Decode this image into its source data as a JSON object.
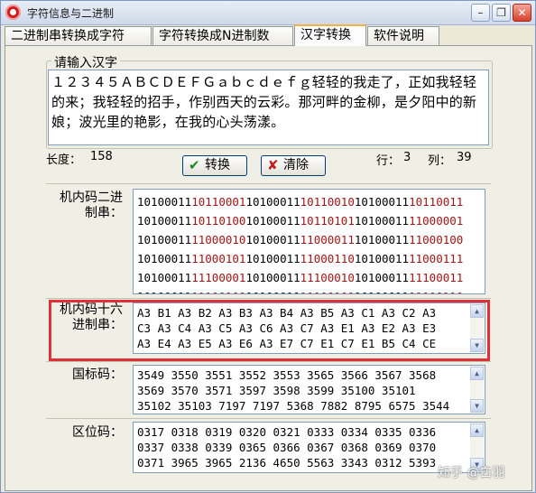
{
  "window": {
    "title": "字符信息与二进制",
    "controls": {
      "minimize": "–",
      "restore": "❐",
      "close": "✕"
    }
  },
  "tabs": [
    {
      "label": "二进制串转换成字符",
      "active": false
    },
    {
      "label": "字符转换成N进制数",
      "active": false
    },
    {
      "label": "汉字转换",
      "active": true
    },
    {
      "label": "软件说明",
      "active": false
    }
  ],
  "input_group": {
    "legend": "请输入汉字",
    "text": "１２３４５ＡＢＣＤＥＦＧａｂｃｄｅｆｇ轻轻的我走了，正如我轻轻的来；我轻轻的招手，作别西天的云彩。那河畔的金柳，是夕阳中的新娘；波光里的艳影，在我的心头荡漾。"
  },
  "stats": {
    "length_label": "长度：",
    "length_value": "158",
    "row_label": "行：",
    "row_value": "3",
    "col_label": "列：",
    "col_value": "39"
  },
  "buttons": {
    "convert": "转换",
    "clear": "清除"
  },
  "binary": {
    "label": "机内码二进制串：",
    "lines": [
      [
        "10100011",
        "10110001",
        "10100011",
        "10110010",
        "10100011",
        "10110011"
      ],
      [
        "10100011",
        "10110100",
        "10100011",
        "10110101",
        "10100011",
        "11000001"
      ],
      [
        "10100011",
        "11000010",
        "10100011",
        "11000011",
        "10100011",
        "11000100"
      ],
      [
        "10100011",
        "11000101",
        "10100011",
        "11000110",
        "10100011",
        "11000111"
      ],
      [
        "10100011",
        "11100001",
        "10100011",
        "11100010",
        "10100011",
        "11100011"
      ],
      [
        "10100011",
        "11100100",
        "10100011",
        "11100101",
        "10100011",
        "11100110"
      ]
    ]
  },
  "hex": {
    "label": "机内码十六进制串：",
    "lines": [
      "A3 B1 A3 B2 A3 B3 A3 B4 A3 B5 A3 C1 A3 C2 A3",
      "C3 A3 C4 A3 C5 A3 C6 A3 C7 A3 E1 A3 E2 A3 E3",
      "A3 E4 A3 E5 A3 E6 A3 E7 C7 E1 C7 E1 B5 C4 CE"
    ]
  },
  "guobiao": {
    "label": "国标码：",
    "lines": [
      "3549 3550 3551 3552 3553 3565 3566 3567 3568",
      "3569 3570 3571 3597 3598 3599 35100 35101",
      "35102 35103 7197 7197 5368 7882 8795 6575 3544"
    ]
  },
  "quwei": {
    "label": "区位码：",
    "lines": [
      "0317 0318 0319 0320 0321 0333 0334 0335 0336",
      "0337 0338 0339 0365 0366 0367 0368 0369 0370",
      "0371 3965 3965 2136 4650 5563 3343 0312 5393"
    ]
  },
  "watermark": "知乎 @白羽",
  "colors": {
    "highlight": "#e0303a",
    "binary_alt": "#a01515",
    "tab_active_accent": "#f1b43c"
  }
}
